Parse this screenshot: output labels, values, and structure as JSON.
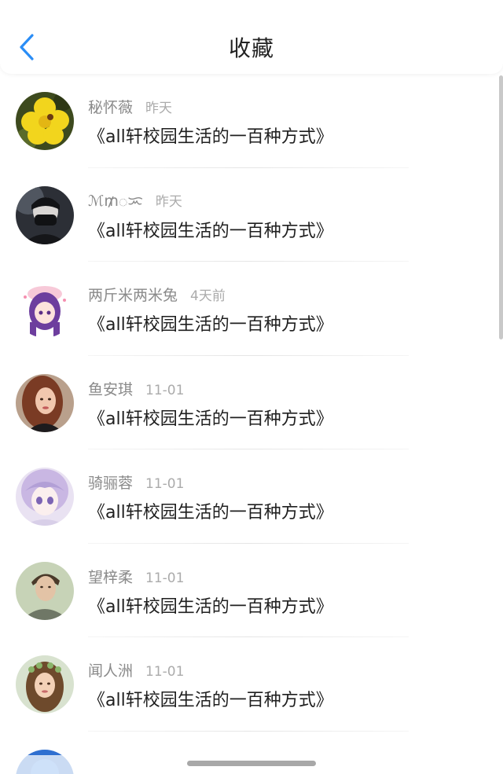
{
  "header": {
    "back_icon": "chevron-left-icon",
    "title": "收藏",
    "accent_color": "#2a8df6"
  },
  "favorites": [
    {
      "name": "秘怀薇",
      "time": "昨天",
      "title": "《all轩校园生活的一百种方式》",
      "avatar": "yellow-flower"
    },
    {
      "name": "ℳ₥ᜀᜁ",
      "time": "昨天",
      "title": "《all轩校园生活的一百种方式》",
      "avatar": "masked-person-dark"
    },
    {
      "name": "两斤米两米兔",
      "time": "4天前",
      "title": "《all轩校园生活的一百种方式》",
      "avatar": "anime-girl-purple-hair"
    },
    {
      "name": "鱼安琪",
      "time": "11-01",
      "title": "《all轩校园生活的一百种方式》",
      "avatar": "woman-portrait"
    },
    {
      "name": "骑骊蓉",
      "time": "11-01",
      "title": "《all轩校园生活的一百种方式》",
      "avatar": "anime-girl-lavender"
    },
    {
      "name": "望梓柔",
      "time": "11-01",
      "title": "《all轩校园生活的一百种方式》",
      "avatar": "young-man-portrait"
    },
    {
      "name": "闻人洲",
      "time": "11-01",
      "title": "《all轩校园生活的一百种方式》",
      "avatar": "woman-flower-crown"
    }
  ],
  "partial_item": {
    "name": "",
    "avatar": "blue-avatar-partial"
  }
}
